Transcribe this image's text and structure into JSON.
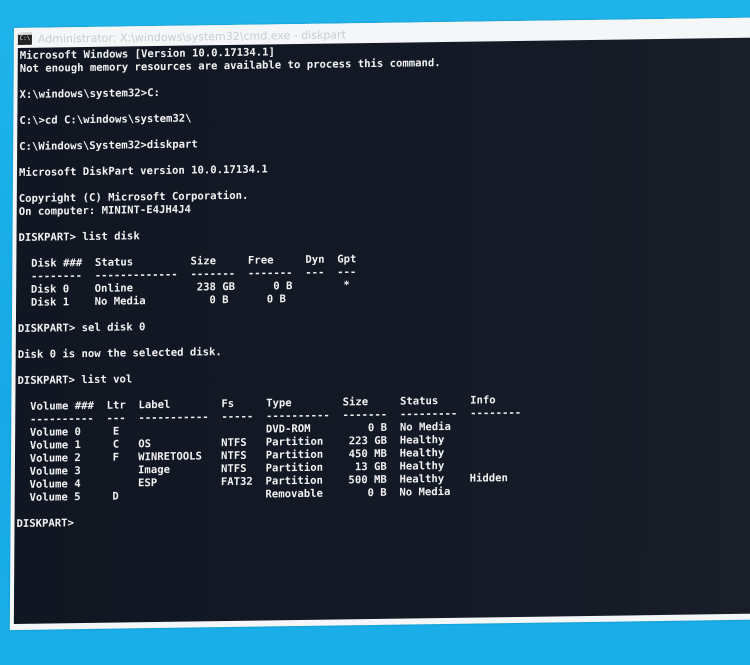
{
  "window": {
    "title": "Administrator: X:\\windows\\system32\\cmd.exe - diskpart",
    "icon": "cmd-icon"
  },
  "console": {
    "lines": [
      "Microsoft Windows [Version 10.0.17134.1]",
      "Not enough memory resources are available to process this command.",
      "",
      "X:\\windows\\system32>C:",
      "",
      "C:\\>cd C:\\windows\\system32\\",
      "",
      "C:\\Windows\\System32>diskpart",
      "",
      "Microsoft DiskPart version 10.0.17134.1",
      "",
      "Copyright (C) Microsoft Corporation.",
      "On computer: MININT-E4JH4J4",
      "",
      "DISKPART> list disk",
      "",
      "  Disk ###  Status         Size     Free     Dyn  Gpt",
      "  --------  -------------  -------  -------  ---  ---",
      "  Disk 0    Online          238 GB      0 B        *",
      "  Disk 1    No Media          0 B      0 B",
      "",
      "DISKPART> sel disk 0",
      "",
      "Disk 0 is now the selected disk.",
      "",
      "DISKPART> list vol",
      "",
      "  Volume ###  Ltr  Label        Fs     Type        Size     Status     Info",
      "  ----------  ---  -----------  -----  ----------  -------  ---------  --------",
      "  Volume 0     E                       DVD-ROM         0 B  No Media",
      "  Volume 1     C   OS           NTFS   Partition    223 GB  Healthy",
      "  Volume 2     F   WINRETOOLS   NTFS   Partition    450 MB  Healthy",
      "  Volume 3         Image        NTFS   Partition     13 GB  Healthy",
      "  Volume 4         ESP          FAT32  Partition    500 MB  Healthy    Hidden",
      "  Volume 5     D                       Removable       0 B  No Media",
      "",
      "DISKPART> "
    ]
  },
  "disks": {
    "headers": [
      "Disk ###",
      "Status",
      "Size",
      "Free",
      "Dyn",
      "Gpt"
    ],
    "rows": [
      [
        "Disk 0",
        "Online",
        "238 GB",
        "0 B",
        "",
        "*"
      ],
      [
        "Disk 1",
        "No Media",
        "0 B",
        "0 B",
        "",
        ""
      ]
    ]
  },
  "volumes": {
    "headers": [
      "Volume ###",
      "Ltr",
      "Label",
      "Fs",
      "Type",
      "Size",
      "Status",
      "Info"
    ],
    "rows": [
      [
        "Volume 0",
        "E",
        "",
        "",
        "DVD-ROM",
        "0 B",
        "No Media",
        ""
      ],
      [
        "Volume 1",
        "C",
        "OS",
        "NTFS",
        "Partition",
        "223 GB",
        "Healthy",
        ""
      ],
      [
        "Volume 2",
        "F",
        "WINRETOOLS",
        "NTFS",
        "Partition",
        "450 MB",
        "Healthy",
        ""
      ],
      [
        "Volume 3",
        "",
        "Image",
        "NTFS",
        "Partition",
        "13 GB",
        "Healthy",
        ""
      ],
      [
        "Volume 4",
        "",
        "ESP",
        "FAT32",
        "Partition",
        "500 MB",
        "Healthy",
        "Hidden"
      ],
      [
        "Volume 5",
        "D",
        "",
        "",
        "Removable",
        "0 B",
        "No Media",
        ""
      ]
    ]
  },
  "colors": {
    "desktop": "#1fb4ea",
    "console_bg": "#131926",
    "console_fg": "#f2f2f2",
    "titlebar_bg": "#f4f6f8"
  }
}
